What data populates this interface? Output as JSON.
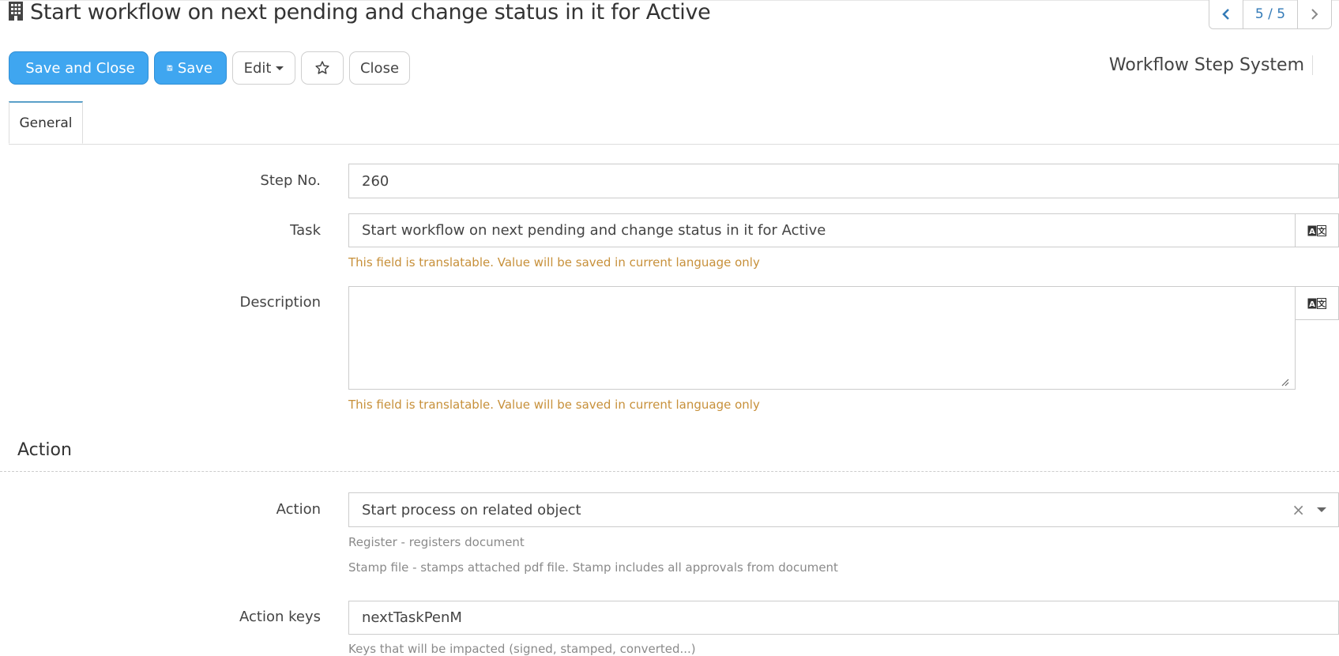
{
  "header": {
    "title": "Start workflow on next pending and change status in it for Active",
    "title_icon": "building-icon",
    "entity_type": "Workflow Step System"
  },
  "pager": {
    "count": "5 / 5"
  },
  "toolbar": {
    "save_close": "Save and Close",
    "save": "Save",
    "edit": "Edit",
    "close": "Close"
  },
  "tabs": [
    {
      "label": "General"
    }
  ],
  "form": {
    "step_no": {
      "label": "Step No.",
      "value": "260"
    },
    "task": {
      "label": "Task",
      "value": "Start workflow on next pending and change status in it for Active",
      "help": "This field is translatable. Value will be saved in current language only"
    },
    "description": {
      "label": "Description",
      "value": "",
      "help": "This field is translatable. Value will be saved in current language only"
    }
  },
  "section_action": {
    "title": "Action",
    "action": {
      "label": "Action",
      "value": "Start process on related object",
      "help1": "Register - registers document",
      "help2": "Stamp file - stamps attached pdf file. Stamp includes all approvals from document"
    },
    "action_keys": {
      "label": "Action keys",
      "value": "nextTaskPenM",
      "help": "Keys that will be impacted (signed, stamped, converted...)"
    }
  },
  "colors": {
    "primary": "#3fa6f0",
    "link": "#337ab7",
    "warning_text": "#c7903a",
    "tab_accent": "#5aa0c8"
  }
}
